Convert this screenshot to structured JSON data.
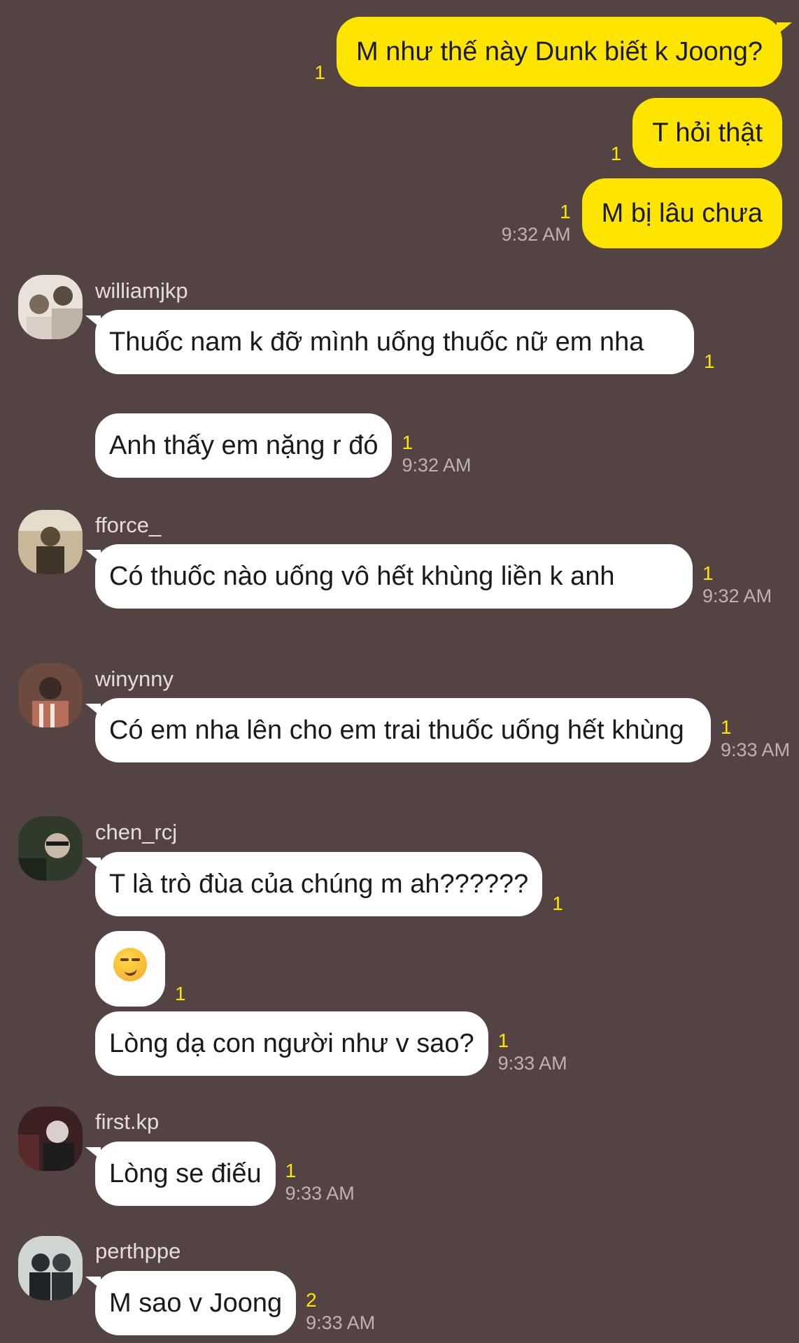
{
  "outgoing": [
    {
      "text": "M như thế này Dunk biết k Joong?",
      "unread": "1",
      "time": ""
    },
    {
      "text": "T hỏi thật",
      "unread": "1",
      "time": ""
    },
    {
      "text": "M bị lâu chưa",
      "unread": "1",
      "time": "9:32 AM"
    }
  ],
  "groups": [
    {
      "sender": "williamjkp",
      "avatar_colors": [
        "#e9e2da",
        "#7a6a5c"
      ],
      "messages": [
        {
          "text": "Thuốc nam k đỡ mình uống thuốc nữ em nha",
          "unread": "1",
          "time": ""
        },
        {
          "text": "Anh thấy em nặng r đó",
          "unread": "1",
          "time": "9:32 AM"
        }
      ]
    },
    {
      "sender": "fforce_",
      "avatar_colors": [
        "#c9b79a",
        "#5a4a36"
      ],
      "messages": [
        {
          "text": "Có thuốc nào uống vô hết khùng liền k anh",
          "unread": "1",
          "time": "9:32 AM"
        }
      ]
    },
    {
      "sender": "winynny",
      "avatar_colors": [
        "#b86c5a",
        "#3a2a26"
      ],
      "messages": [
        {
          "text": "Có em nha lên cho em trai thuốc uống hết khùng",
          "unread": "1",
          "time": "9:33 AM"
        }
      ]
    },
    {
      "sender": "chen_rcj",
      "avatar_colors": [
        "#2e3a2a",
        "#c8b8a8"
      ],
      "messages": [
        {
          "text": "T là trò đùa của chúng m ah??????",
          "unread": "1",
          "time": ""
        },
        {
          "text": "",
          "emoji": "smirking-face",
          "unread": "1",
          "time": ""
        },
        {
          "text": "Lòng dạ con người như v sao?",
          "unread": "1",
          "time": "9:33 AM"
        }
      ]
    },
    {
      "sender": "first.kp",
      "avatar_colors": [
        "#3a2020",
        "#d7d0cc"
      ],
      "messages": [
        {
          "text": "Lòng se điếu",
          "unread": "1",
          "time": "9:33 AM"
        }
      ]
    },
    {
      "sender": "perthppe",
      "avatar_colors": [
        "#cfd6d2",
        "#2a2e33"
      ],
      "messages": [
        {
          "text": "M sao v Joong",
          "unread": "2",
          "time": "9:33 AM"
        }
      ]
    }
  ]
}
